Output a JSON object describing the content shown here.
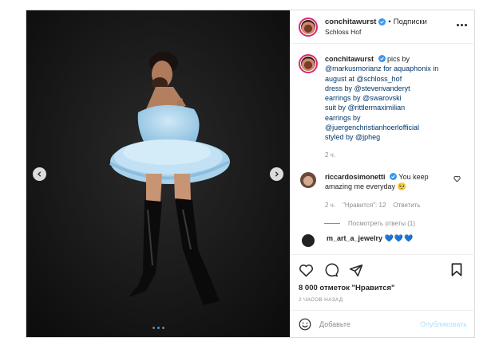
{
  "post": {
    "username": "conchitawurst",
    "follow_label": "Подписки",
    "separator": "•",
    "location": "Schloss Hof",
    "caption_lines": [
      "@markusmorianz for aquaphonix in",
      "august at @schloss_hof",
      "dress by @stevenvanderyt",
      "earrings by @swarovski",
      "suit by @rittlermaximilian",
      "earrings by",
      "@juergenchristianhoerlofficial",
      "styled by @jpheg"
    ],
    "caption_first": "pics by",
    "time": "2 ч.",
    "likes": "8 000 отметок \"Нравится\"",
    "posted_ago": "2 ЧАСОВ НАЗАД",
    "carousel": {
      "total": 3,
      "active": 1
    }
  },
  "comment": {
    "username": "riccardosimonetti",
    "text": "You keep amazing me everyday",
    "emoji": "🥺",
    "time": "2 ч.",
    "likes": "\"Нравится\": 12",
    "reply": "Ответить",
    "view_replies": "Посмотреть ответы (1)"
  },
  "comment2": {
    "username": "m_art_a_jewelry",
    "hearts": "💙💙💙"
  },
  "add_comment": {
    "placeholder": "Добавьте",
    "publish": "Опубликовать"
  },
  "icons": {
    "like": "heart-icon",
    "comment": "comment-icon",
    "share": "share-icon",
    "save": "bookmark-icon",
    "emoji": "smile-icon",
    "more": "more-icon",
    "verified": "verified-badge-icon"
  },
  "colors": {
    "link": "#00376b",
    "verified": "#3897f0",
    "meta": "#8e8e8e",
    "publish_disabled": "#b2dffc"
  }
}
